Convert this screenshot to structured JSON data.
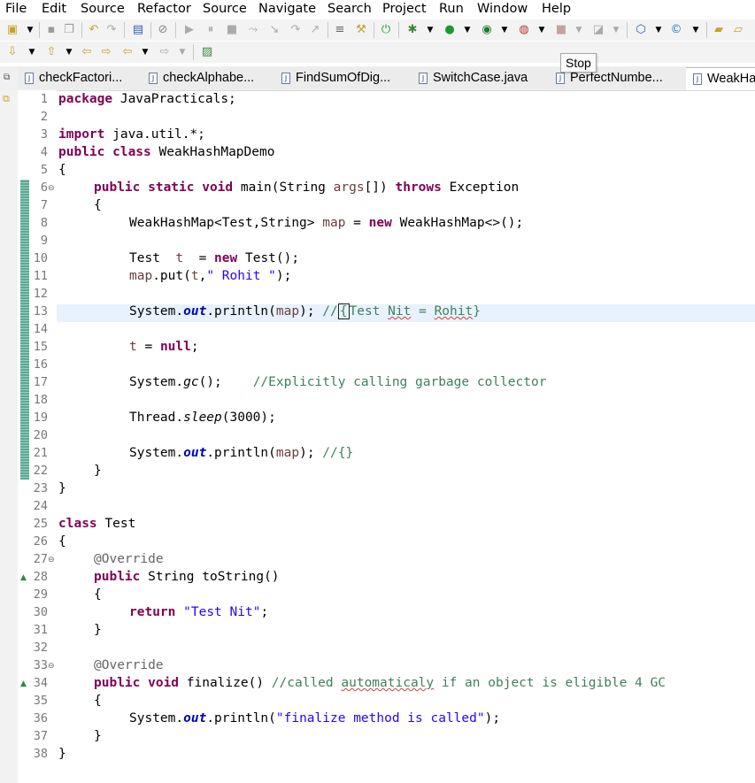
{
  "menu": [
    "File",
    "Edit",
    "Source",
    "Refactor",
    "Source",
    "Navigate",
    "Search",
    "Project",
    "Run",
    "Window",
    "Help"
  ],
  "tabs": [
    {
      "label": "checkFactori..."
    },
    {
      "label": "checkAlphabe..."
    },
    {
      "label": "FindSumOfDig..."
    },
    {
      "label": "SwitchCase.java"
    },
    {
      "label": "PerfectNumbe..."
    },
    {
      "label": "WeakHa"
    }
  ],
  "tooltip": "Stop",
  "editor": {
    "lines": [
      "1",
      "2",
      "3",
      "4",
      "5",
      "6",
      "7",
      "8",
      "9",
      "10",
      "11",
      "12",
      "13",
      "14",
      "15",
      "16",
      "17",
      "18",
      "19",
      "20",
      "21",
      "22",
      "23",
      "24",
      "25",
      "26",
      "27",
      "28",
      "29",
      "30",
      "31",
      "32",
      "33",
      "34",
      "35",
      "36",
      "37",
      "38"
    ],
    "code": {
      "l1": {
        "kw": "package",
        "rest": " JavaPracticals;"
      },
      "l3": {
        "kw": "import",
        "rest": " java.util.*;"
      },
      "l4": {
        "kw": "public class",
        "rest": " WeakHashMapDemo"
      },
      "l5": "{",
      "l6": {
        "kw1": "public static void",
        "a": " main(String ",
        "var": "args",
        "b": "[]) ",
        "kw2": "throws",
        "c": " Exception"
      },
      "l7": "{",
      "l8": {
        "a": "WeakHashMap<Test,String> ",
        "var": "map",
        "b": " = ",
        "kw": "new",
        "c": " WeakHashMap<>();"
      },
      "l10": {
        "a": "Test  ",
        "var": "t",
        "b": "  = ",
        "kw": "new",
        "c": " Test();"
      },
      "l11": {
        "var": "map",
        "a": ".put(",
        "var2": "t",
        "b": ",",
        "str": "\" Rohit \"",
        "c": ");"
      },
      "l13": {
        "a": "System.",
        "field": "out",
        "b": ".println(",
        "var": "map",
        "c": "); ",
        "cm1": "//",
        "cur": "{",
        "cm2": "Test ",
        "sq1": "Nit",
        "cm3": " = ",
        "sq2": "Rohit",
        "cm4": "}"
      },
      "l15": {
        "var": "t",
        "a": " = ",
        "kw": "null",
        "b": ";"
      },
      "l17": {
        "a": "System.",
        "sm": "gc",
        "b": "();    ",
        "cm": "//Explicitly calling garbage collector"
      },
      "l19": {
        "a": "Thread.",
        "sm": "sleep",
        "b": "(3000);"
      },
      "l21": {
        "a": "System.",
        "field": "out",
        "b": ".println(",
        "var": "map",
        "c": "); ",
        "cm": "//{}"
      },
      "l22": "}",
      "l23": "}",
      "l25": {
        "kw": "class",
        "rest": " Test"
      },
      "l26": "{",
      "l27": "@Override",
      "l28": {
        "kw": "public",
        "rest": " String toString()"
      },
      "l29": "{",
      "l30": {
        "kw": "return",
        "sp": " ",
        "str": "\"Test Nit\"",
        "rest": ";"
      },
      "l31": "}",
      "l33": "@Override",
      "l34": {
        "kw": "public void",
        "a": " finalize() ",
        "cm1": "//called ",
        "sq": "automaticaly",
        "cm2": " if an object is eligible 4 GC"
      },
      "l35": "{",
      "l36": {
        "a": "System.",
        "field": "out",
        "b": ".println(",
        "str": "\"finalize method is called\"",
        "c": ");"
      },
      "l37": "}",
      "l38": "}"
    }
  }
}
